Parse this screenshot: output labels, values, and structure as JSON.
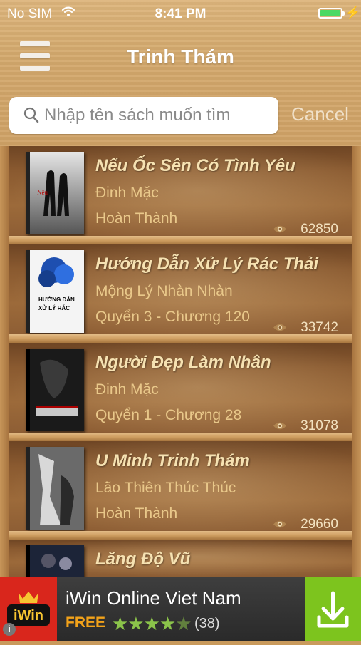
{
  "status_bar": {
    "carrier": "No SIM",
    "time": "8:41 PM"
  },
  "header": {
    "title": "Trinh Thám",
    "menu_icon": "hamburger-icon"
  },
  "search": {
    "placeholder": "Nhập tên sách muốn tìm",
    "value": "",
    "cancel_label": "Cancel"
  },
  "books": [
    {
      "title": "Nếu Ốc Sên Có Tình Yêu",
      "author": "Đinh Mặc",
      "status": "Hoàn Thành",
      "views": "62850"
    },
    {
      "title": "Hướng Dẫn Xử Lý Rác Thải",
      "author": "Mộng Lý Nhàn Nhàn",
      "status": "Quyển 3 - Chương 120",
      "views": "33742"
    },
    {
      "title": "Người Đẹp Làm Nhân",
      "author": "Đinh Mặc",
      "status": "Quyển 1 - Chương 28",
      "views": "31078"
    },
    {
      "title": "U Minh Trinh Thám",
      "author": "Lão Thiên Thúc Thúc",
      "status": "Hoàn Thành",
      "views": "29660"
    },
    {
      "title": "Lăng Độ Vũ",
      "author": "",
      "status": "",
      "views": ""
    }
  ],
  "ad": {
    "title": "iWin Online Viet Nam",
    "price": "FREE",
    "rating": 4.5,
    "rating_count": "(38)",
    "logo_text": "iWin",
    "accent": "#7dc41e"
  },
  "colors": {
    "wood": "#d3a86c",
    "title_text": "#f6e2b2",
    "sub_text": "#e9c88a"
  }
}
